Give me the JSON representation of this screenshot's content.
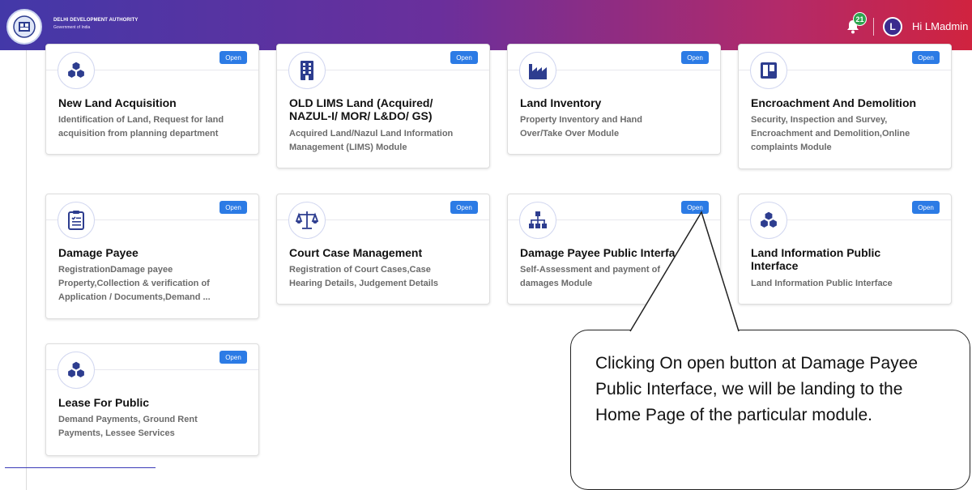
{
  "header": {
    "org_name": "DELHI DEVELOPMENT AUTHORITY",
    "org_sub": "Government of India",
    "notification_count": "21",
    "avatar_initial": "L",
    "greeting": "Hi LMadmin"
  },
  "cards": [
    {
      "title": "New Land Acquisition",
      "desc1": "Identification of Land, Request for land",
      "desc2": "acquisition from planning department",
      "button": "Open",
      "icon": "cubes-icon"
    },
    {
      "title": "OLD LIMS Land (Acquired/ NAZUL-I/ MOR/ L&DO/ GS)",
      "desc1": "Acquired Land/Nazul Land Information",
      "desc2": "Management (LIMS) Module",
      "button": "Open",
      "icon": "building-icon"
    },
    {
      "title": "Land Inventory",
      "desc1": "Property Inventory and Hand",
      "desc2": "Over/Take Over Module",
      "button": "Open",
      "icon": "factory-icon"
    },
    {
      "title": "Encroachment And Demolition",
      "desc1": "Security, Inspection and Survey,",
      "desc2": "Encroachment and Demolition,Online",
      "desc3": "complaints Module",
      "button": "Open",
      "icon": "board-icon"
    },
    {
      "title": "Damage Payee",
      "desc1": "RegistrationDamage payee",
      "desc2": "Property,Collection & verification of",
      "desc3": "Application / Documents,Demand ...",
      "button": "Open",
      "icon": "document-icon"
    },
    {
      "title": "Court Case Management",
      "desc1": "Registration of Court Cases,Case",
      "desc2": "Hearing Details, Judgement Details",
      "button": "Open",
      "icon": "scales-icon"
    },
    {
      "title": "Damage Payee Public Interfa",
      "desc1": "Self-Assessment and payment of",
      "desc2": "damages Module",
      "button": "Open",
      "icon": "sitemap-icon"
    },
    {
      "title": "Land Information Public Interface",
      "desc1": "Land Information Public Interface",
      "button": "Open",
      "icon": "cubes-icon"
    },
    {
      "title": "Lease For Public",
      "desc1": "Demand Payments, Ground Rent",
      "desc2": "Payments, Lessee Services",
      "button": "Open",
      "icon": "cubes-icon"
    }
  ],
  "callout": {
    "text": "Clicking On open button at Damage Payee Public Interface, we will be landing to the Home Page of the particular module."
  },
  "colors": {
    "header_start": "#4338a8",
    "header_end": "#d0233f",
    "open_button": "#2c7be5",
    "icon_color": "#2d3d8f"
  }
}
